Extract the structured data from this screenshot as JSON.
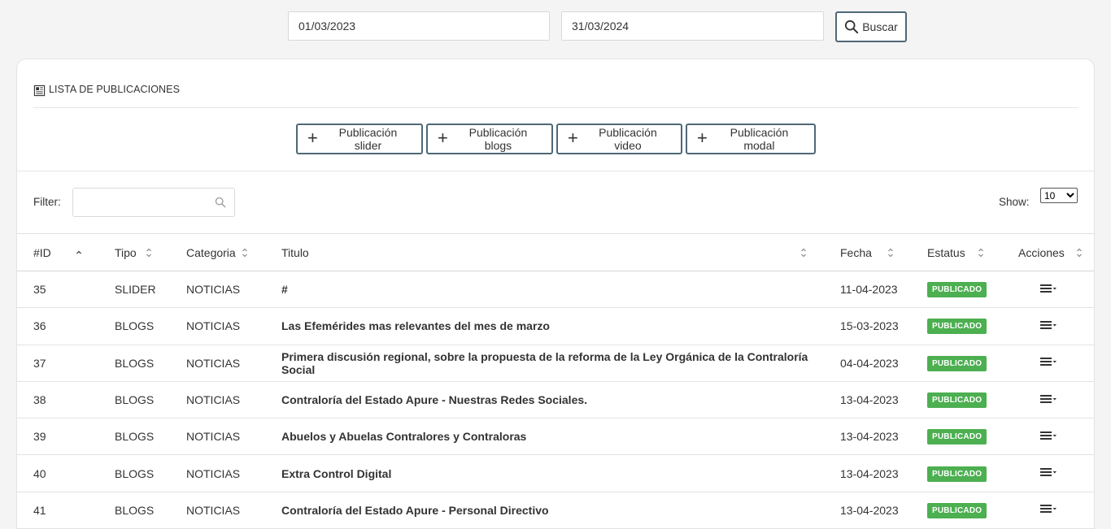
{
  "search": {
    "date_from": "01/03/2023",
    "date_to": "31/03/2024",
    "button_label": "Buscar"
  },
  "card": {
    "title": "LISTA DE PUBLICACIONES",
    "buttons": {
      "slider": "Publicación slider",
      "blogs": "Publicación blogs",
      "video": "Publicación video",
      "modal": "Publicación modal"
    }
  },
  "filter": {
    "label": "Filter:",
    "placeholder": ""
  },
  "show": {
    "label": "Show:",
    "selected": "10"
  },
  "table": {
    "columns": [
      "#ID",
      "Tipo",
      "Categoria",
      "Titulo",
      "Fecha",
      "Estatus",
      "Acciones"
    ],
    "rows": [
      {
        "id": "35",
        "tipo": "SLIDER",
        "categoria": "NOTICIAS",
        "titulo": "#",
        "fecha": "11-04-2023",
        "estatus": "PUBLICADO"
      },
      {
        "id": "36",
        "tipo": "BLOGS",
        "categoria": "NOTICIAS",
        "titulo": "Las Efemérides mas relevantes del mes de marzo",
        "fecha": "15-03-2023",
        "estatus": "PUBLICADO"
      },
      {
        "id": "37",
        "tipo": "BLOGS",
        "categoria": "NOTICIAS",
        "titulo": "Primera discusión regional, sobre la propuesta de la reforma de la Ley Orgánica de la Contraloría Social",
        "fecha": "04-04-2023",
        "estatus": "PUBLICADO"
      },
      {
        "id": "38",
        "tipo": "BLOGS",
        "categoria": "NOTICIAS",
        "titulo": "Contraloría del Estado Apure - Nuestras Redes Sociales.",
        "fecha": "13-04-2023",
        "estatus": "PUBLICADO"
      },
      {
        "id": "39",
        "tipo": "BLOGS",
        "categoria": "NOTICIAS",
        "titulo": "Abuelos y Abuelas Contralores y Contraloras",
        "fecha": "13-04-2023",
        "estatus": "PUBLICADO"
      },
      {
        "id": "40",
        "tipo": "BLOGS",
        "categoria": "NOTICIAS",
        "titulo": "Extra Control Digital",
        "fecha": "13-04-2023",
        "estatus": "PUBLICADO"
      },
      {
        "id": "41",
        "tipo": "BLOGS",
        "categoria": "NOTICIAS",
        "titulo": "Contraloría del Estado Apure - Personal Directivo",
        "fecha": "13-04-2023",
        "estatus": "PUBLICADO"
      }
    ]
  },
  "colors": {
    "badge_green": "#4caf50",
    "button_border": "#4f6877"
  },
  "icons": {
    "search": "search-icon",
    "list": "newspaper-icon",
    "plus": "plus-icon",
    "sort": "sort-icon",
    "menu": "menu-dropdown-icon"
  }
}
